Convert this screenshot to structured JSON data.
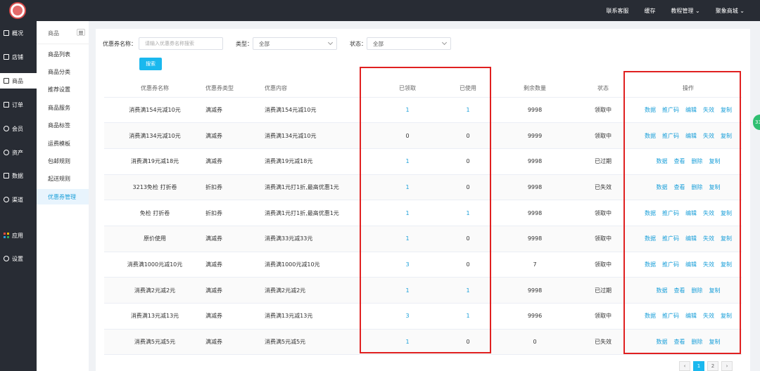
{
  "topbar": {
    "links": [
      "联系客服",
      "缓存",
      "教程管理 ⌄",
      "聚象商城 ⌄"
    ]
  },
  "sidebar": {
    "items": [
      {
        "label": "概况",
        "icon": "monitor-icon"
      },
      {
        "label": "店铺",
        "icon": "store-icon"
      },
      {
        "label": "商品",
        "icon": "goods-icon",
        "active": true
      },
      {
        "label": "订单",
        "icon": "order-icon"
      },
      {
        "label": "会员",
        "icon": "user-icon"
      },
      {
        "label": "资产",
        "icon": "asset-icon"
      },
      {
        "label": "数据",
        "icon": "data-icon"
      },
      {
        "label": "渠道",
        "icon": "channel-icon"
      },
      {
        "label": "应用",
        "icon": "apps-icon"
      },
      {
        "label": "设置",
        "icon": "settings-icon"
      }
    ]
  },
  "subsidebar": {
    "title": "商品",
    "items": [
      "商品列表",
      "商品分类",
      "推荐设置",
      "商品服务",
      "商品标签",
      "运费模板",
      "包邮规则",
      "起送规则",
      "优惠券管理"
    ],
    "active_index": 8
  },
  "filters": {
    "name_label": "优惠券名称：",
    "name_placeholder": "请输入优惠券名称搜索",
    "type_label": "类型：",
    "type_value": "全部",
    "status_label": "状态：",
    "status_value": "全部",
    "search_button": "搜索"
  },
  "table": {
    "headers": [
      "优惠券名称",
      "优惠券类型",
      "优惠内容",
      "已领取",
      "已使用",
      "剩余数量",
      "状态",
      "操作"
    ],
    "rows": [
      {
        "name": "消费满154元减10元",
        "type": "满减券",
        "content": "消费满154元减10元",
        "received": "1",
        "used": "1",
        "remaining": "9998",
        "status": "领取中",
        "ops": [
          "数据",
          "推广码",
          "编辑",
          "失效",
          "复制"
        ]
      },
      {
        "name": "消费满134元减10元",
        "type": "满减券",
        "content": "消费满134元减10元",
        "received": "0",
        "used": "0",
        "remaining": "9999",
        "status": "领取中",
        "ops": [
          "数据",
          "推广码",
          "编辑",
          "失效",
          "复制"
        ]
      },
      {
        "name": "消费满19元减18元",
        "type": "满减券",
        "content": "消费满19元减18元",
        "received": "1",
        "used": "0",
        "remaining": "9998",
        "status": "已过期",
        "ops": [
          "数据",
          "查看",
          "删除",
          "复制"
        ]
      },
      {
        "name": "3213免检 打折卷",
        "type": "折扣券",
        "content": "消费满1元打1折,最高优惠1元",
        "received": "1",
        "used": "0",
        "remaining": "9998",
        "status": "已失效",
        "ops": [
          "数据",
          "查看",
          "删除",
          "复制"
        ]
      },
      {
        "name": "免检 打折卷",
        "type": "折扣券",
        "content": "消费满1元打1折,最高优惠1元",
        "received": "1",
        "used": "1",
        "remaining": "9998",
        "status": "领取中",
        "ops": [
          "数据",
          "推广码",
          "编辑",
          "失效",
          "复制"
        ]
      },
      {
        "name": "原价使用",
        "type": "满减券",
        "content": "消费满33元减33元",
        "received": "1",
        "used": "0",
        "remaining": "9998",
        "status": "领取中",
        "ops": [
          "数据",
          "推广码",
          "编辑",
          "失效",
          "复制"
        ]
      },
      {
        "name": "消费满1000元减10元",
        "type": "满减券",
        "content": "消费满1000元减10元",
        "received": "3",
        "used": "0",
        "remaining": "7",
        "status": "领取中",
        "ops": [
          "数据",
          "推广码",
          "编辑",
          "失效",
          "复制"
        ]
      },
      {
        "name": "消费满2元减2元",
        "type": "满减券",
        "content": "消费满2元减2元",
        "received": "1",
        "used": "1",
        "remaining": "9998",
        "status": "已过期",
        "ops": [
          "数据",
          "查看",
          "删除",
          "复制"
        ]
      },
      {
        "name": "消费满13元减13元",
        "type": "满减券",
        "content": "消费满13元减13元",
        "received": "3",
        "used": "1",
        "remaining": "9996",
        "status": "领取中",
        "ops": [
          "数据",
          "推广码",
          "编辑",
          "失效",
          "复制"
        ]
      },
      {
        "name": "消费满5元减5元",
        "type": "满减券",
        "content": "消费满5元减5元",
        "received": "1",
        "used": "0",
        "remaining": "0",
        "status": "已失效",
        "ops": [
          "数据",
          "查看",
          "删除",
          "复制"
        ]
      }
    ]
  },
  "pagination": {
    "prev": "‹",
    "pages": [
      "1",
      "2"
    ],
    "active": "1",
    "next": "›"
  },
  "float_badge": "33",
  "colors": {
    "accent": "#1a9fd9",
    "highlight_box": "#e02020",
    "dark_bg": "#282c34"
  }
}
